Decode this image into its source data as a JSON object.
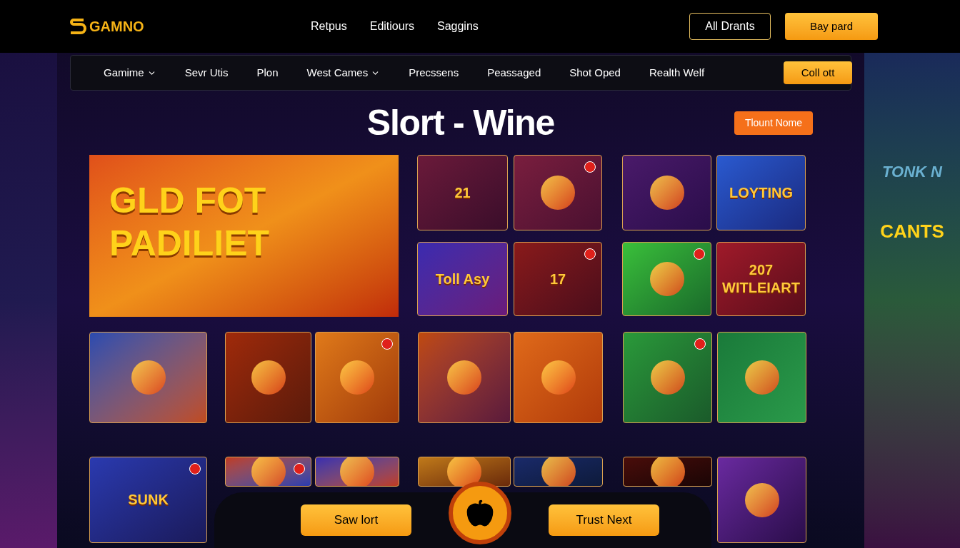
{
  "header": {
    "logo": "GAMNO",
    "links": [
      "Retpus",
      "Editiours",
      "Saggins"
    ],
    "outline_button": "All Drants",
    "primary_button": "Bay pard"
  },
  "nav": {
    "items": [
      {
        "label": "Gamime",
        "dropdown": true
      },
      {
        "label": "Sevr Utis",
        "dropdown": false
      },
      {
        "label": "Plon",
        "dropdown": false
      },
      {
        "label": "West Cames",
        "dropdown": true
      },
      {
        "label": "Precssens",
        "dropdown": false
      },
      {
        "label": "Peassaged",
        "dropdown": false
      },
      {
        "label": "Shot Oped",
        "dropdown": false
      },
      {
        "label": "Realth Welf",
        "dropdown": false
      }
    ],
    "button": "Coll ott"
  },
  "hero": {
    "title": "Slort - Wine",
    "button": "Tlount Nome",
    "banner": [
      "GLD FOT",
      "PADILIET"
    ]
  },
  "tiles_top": [
    {
      "label": "21",
      "badge": false
    },
    {
      "badge": true
    },
    {
      "badge": false
    },
    {
      "label": "LOYTING",
      "badge": false
    },
    {
      "label": "Toll Asy",
      "badge": false
    },
    {
      "label": "17",
      "badge": true
    },
    {
      "badge": true
    },
    {
      "label": "207 WITLEIART",
      "badge": false
    }
  ],
  "tiles_middle": [
    {
      "badge": false
    },
    {
      "badge": false
    },
    {
      "badge": true
    },
    {
      "badge": false
    },
    {
      "badge": false
    },
    {
      "badge": true
    },
    {
      "badge": false
    }
  ],
  "tiles_bottom": [
    {
      "label": "SUNK",
      "badge": true
    },
    {
      "badge": true
    },
    {
      "badge": false
    },
    {
      "badge": false
    },
    {
      "badge": false
    },
    {
      "badge": false
    },
    {
      "badge": false
    }
  ],
  "side_right": {
    "heading": "TONK N",
    "sign": "CANTS"
  },
  "footer": {
    "left_button": "Saw lort",
    "right_button": "Trust Next"
  }
}
